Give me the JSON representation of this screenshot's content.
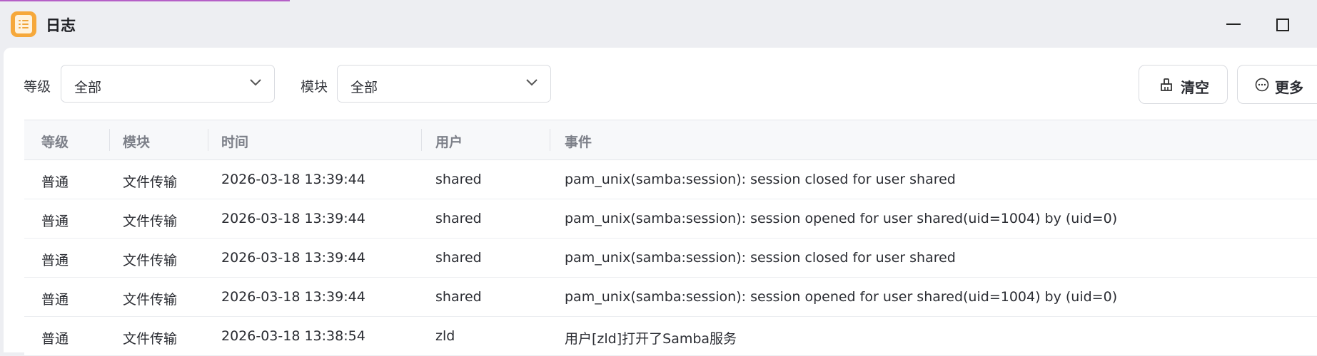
{
  "window": {
    "title": "日志",
    "app_icon": "log-app-icon",
    "minimize_icon": "minimize-icon",
    "maximize_icon": "maximize-icon"
  },
  "filters": {
    "level": {
      "label": "等级",
      "value": "全部"
    },
    "module": {
      "label": "模块",
      "value": "全部"
    }
  },
  "actions": {
    "clear": {
      "label": "清空",
      "icon": "broom-icon"
    },
    "more": {
      "label": "更多",
      "icon": "more-circle-icon"
    }
  },
  "table": {
    "columns": [
      "等级",
      "模块",
      "时间",
      "用户",
      "事件"
    ],
    "rows": [
      {
        "level": "普通",
        "module": "文件传输",
        "time": "2026-03-18 13:39:44",
        "user": "shared",
        "event": "pam_unix(samba:session): session closed for user shared"
      },
      {
        "level": "普通",
        "module": "文件传输",
        "time": "2026-03-18 13:39:44",
        "user": "shared",
        "event": "pam_unix(samba:session): session opened for user shared(uid=1004) by (uid=0)"
      },
      {
        "level": "普通",
        "module": "文件传输",
        "time": "2026-03-18 13:39:44",
        "user": "shared",
        "event": "pam_unix(samba:session): session closed for user shared"
      },
      {
        "level": "普通",
        "module": "文件传输",
        "time": "2026-03-18 13:39:44",
        "user": "shared",
        "event": "pam_unix(samba:session): session opened for user shared(uid=1004) by (uid=0)"
      },
      {
        "level": "普通",
        "module": "文件传输",
        "time": "2026-03-18 13:38:54",
        "user": "zld",
        "event": "用户[zld]打开了Samba服务"
      }
    ]
  },
  "colors": {
    "accent_top_line": "#b55fc7",
    "app_icon": "#f6a83b",
    "header_text": "#7d8089"
  }
}
